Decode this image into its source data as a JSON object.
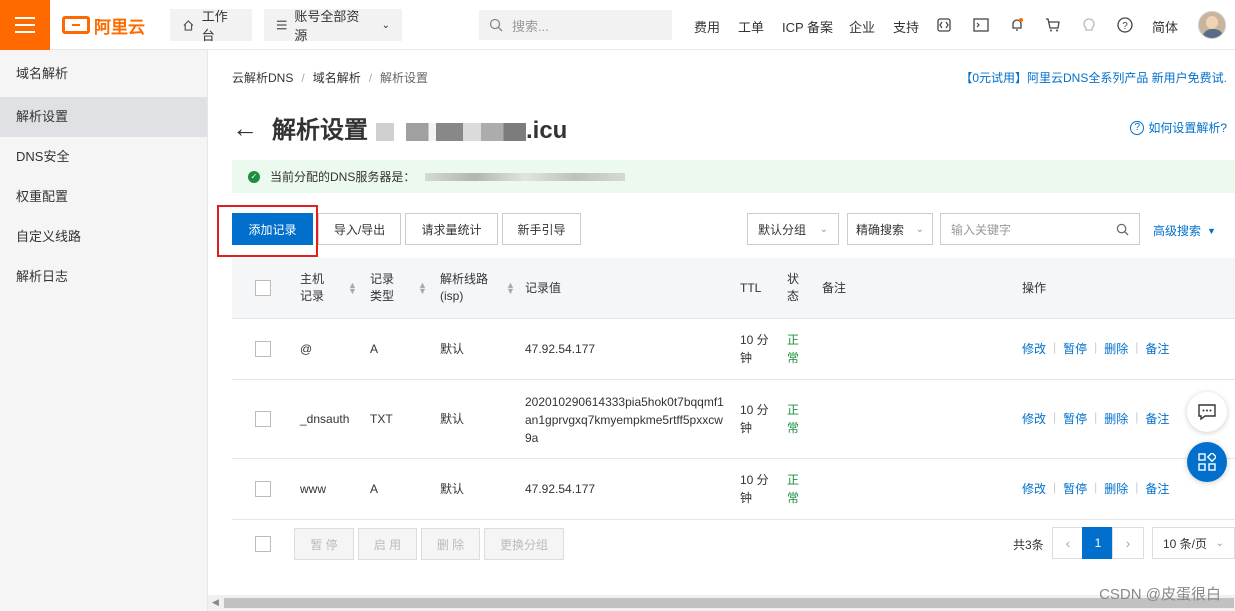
{
  "topbar": {
    "logo_text": "阿里云",
    "workbench": "工作台",
    "resource_scope": "账号全部资源",
    "search_placeholder": "搜索...",
    "links": [
      "费用",
      "工单",
      "ICP 备案",
      "企业",
      "支持"
    ],
    "lang": "简体"
  },
  "sidebar": {
    "title": "域名解析",
    "items": [
      "解析设置",
      "DNS安全",
      "权重配置",
      "自定义线路",
      "解析日志"
    ],
    "active": "解析设置"
  },
  "breadcrumb": [
    "云解析DNS",
    "域名解析",
    "解析设置"
  ],
  "promo": "【0元试用】阿里云DNS全系列产品 新用户免费试.",
  "page": {
    "title": "解析设置",
    "domain_tld": ".icu",
    "help": "如何设置解析?"
  },
  "notice": {
    "text": "当前分配的DNS服务器是："
  },
  "toolbar": {
    "add_record": "添加记录",
    "import_export": "导入/导出",
    "request_stats": "请求量统计",
    "guide": "新手引导",
    "group_select": "默认分组",
    "search_mode": "精确搜索",
    "keyword_placeholder": "输入关键字",
    "advanced_search": "高级搜索"
  },
  "table": {
    "headers": {
      "host": "主机\n记录",
      "type": "记录\n类型",
      "line": "解析线路\n(isp)",
      "value": "记录值",
      "ttl": "TTL",
      "status": "状\n态",
      "remark": "备注",
      "ops": "操作"
    },
    "rows": [
      {
        "host": "@",
        "type": "A",
        "line": "默认",
        "value": "47.92.54.177",
        "ttl": "10 分\n钟",
        "status": "正\n常"
      },
      {
        "host": "_dnsauth",
        "type": "TXT",
        "line": "默认",
        "value": "202010290614333pia5hok0t7bqqmf1\nan1gprvgxq7kmyempkme5rtff5pxxcw\n9a",
        "ttl": "10 分\n钟",
        "status": "正\n常"
      },
      {
        "host": "www",
        "type": "A",
        "line": "默认",
        "value": "47.92.54.177",
        "ttl": "10 分\n钟",
        "status": "正\n常"
      }
    ],
    "ops": [
      "修改",
      "暂停",
      "删除",
      "备注"
    ]
  },
  "footer": {
    "pause": "暂 停",
    "enable": "启 用",
    "delete": "删 除",
    "change_group": "更换分组",
    "total": "共3条",
    "current_page": "1",
    "page_size": "10 条/页"
  },
  "watermark": "CSDN @皮蛋很白"
}
